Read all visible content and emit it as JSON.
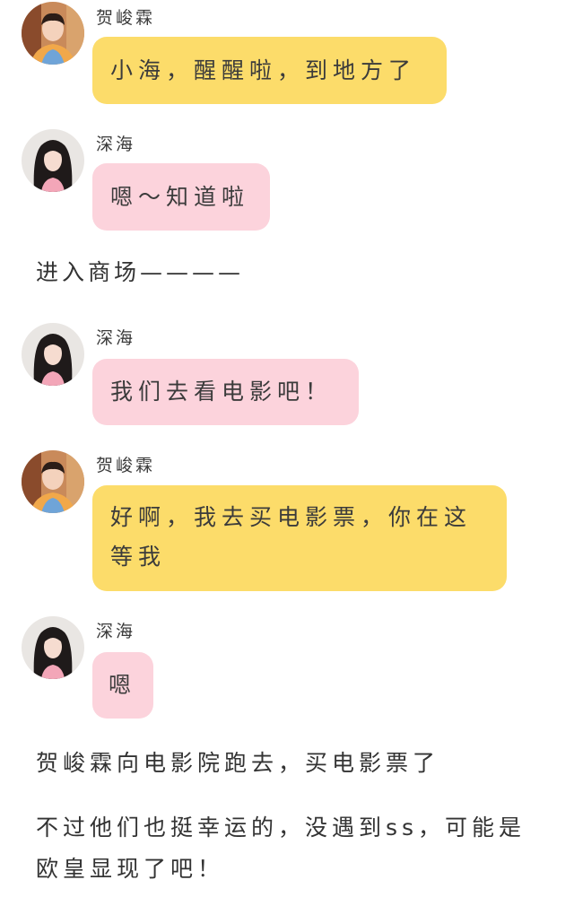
{
  "messages": [
    {
      "sender": "贺峻霖",
      "text": "小海，醒醒啦，到地方了",
      "bubble_color": "#fcdc6a"
    },
    {
      "sender": "深海",
      "text": "嗯～知道啦",
      "bubble_color": "#fcd3dc"
    },
    {
      "sender": "深海",
      "text": "我们去看电影吧！",
      "bubble_color": "#fcd3dc"
    },
    {
      "sender": "贺峻霖",
      "text": "好啊，我去买电影票，你在这等我",
      "bubble_color": "#fcdc6a"
    },
    {
      "sender": "深海",
      "text": "嗯",
      "bubble_color": "#fcd3dc"
    }
  ],
  "narration": [
    "进入商场————",
    "贺峻霖向电影院跑去，买电影票了",
    "不过他们也挺幸运的，没遇到ss，可能是欧皇显现了吧！"
  ],
  "avatars": {
    "he_junlin": "boy-portrait-avatar",
    "shenhai": "girl-portrait-avatar"
  }
}
